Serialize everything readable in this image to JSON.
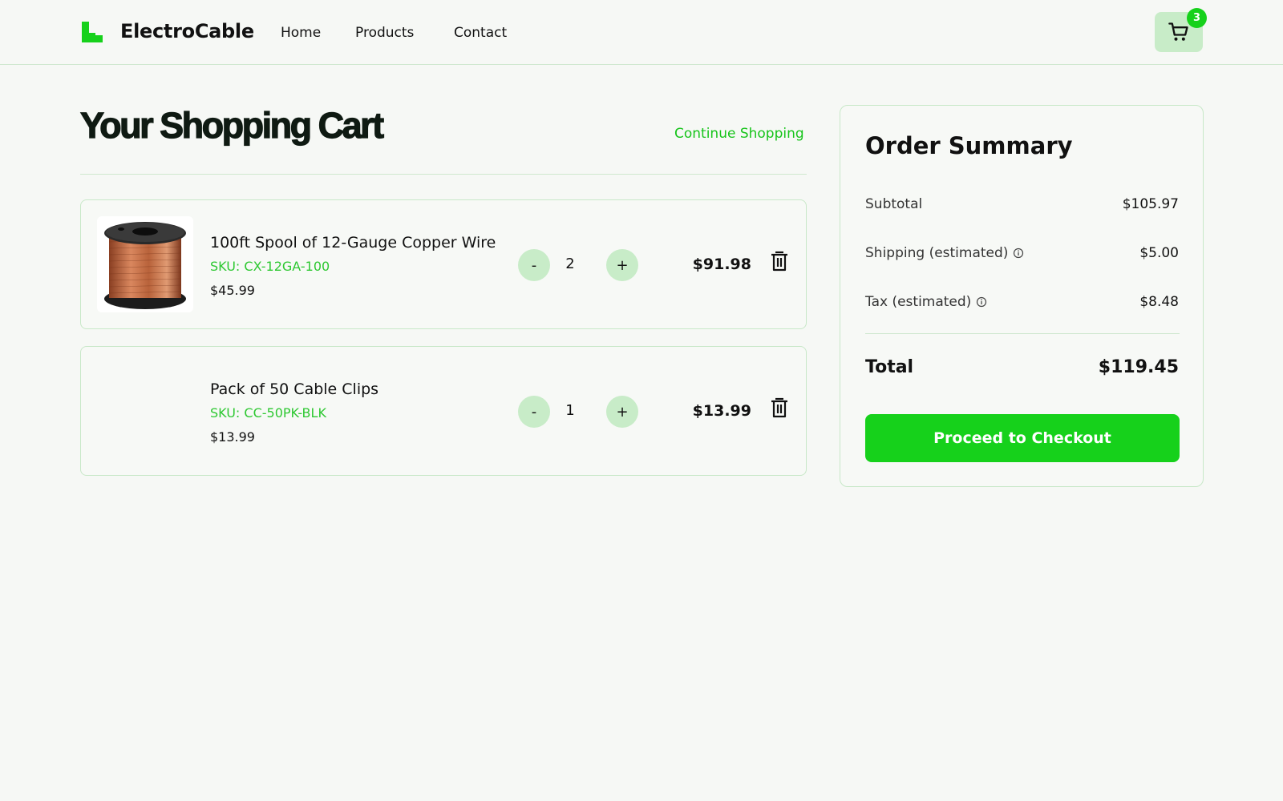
{
  "header": {
    "brand": "ElectroCable",
    "nav": [
      "Home",
      "Products",
      "Contact"
    ],
    "cart_count": "3",
    "icons": {
      "logo": "stair-step-logo",
      "cart": "shopping-cart-icon"
    }
  },
  "cart": {
    "title": "Your Shopping Cart",
    "continue_label": "Continue Shopping",
    "items": [
      {
        "name": "100ft Spool of 12-Gauge Copper Wire",
        "sku": "SKU: CX-12GA-100",
        "unit_price": "$45.99",
        "quantity": "2",
        "line_total": "$91.98",
        "decrement": "-",
        "increment": "+"
      },
      {
        "name": "Pack of 50 Cable Clips",
        "sku": "SKU: CC-50PK-BLK",
        "unit_price": "$13.99",
        "quantity": "1",
        "line_total": "$13.99",
        "decrement": "-",
        "increment": "+"
      }
    ]
  },
  "summary": {
    "title": "Order Summary",
    "subtotal_label": "Subtotal",
    "subtotal_value": "$105.97",
    "shipping_label": "Shipping (estimated)",
    "shipping_value": "$5.00",
    "tax_label": "Tax (estimated)",
    "tax_value": "$8.48",
    "total_label": "Total",
    "total_value": "$119.45",
    "checkout_label": "Proceed to Checkout"
  },
  "colors": {
    "accent": "#16d11b",
    "accent_soft": "#c8ecc8",
    "background": "#f6f8f5",
    "border": "#c8e8c8"
  }
}
